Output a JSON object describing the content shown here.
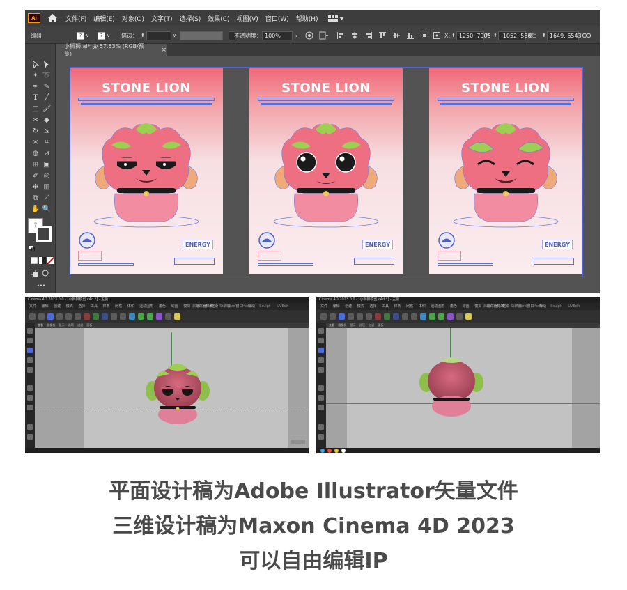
{
  "illustrator": {
    "logo": "Ai",
    "menu": [
      "文件(F)",
      "编辑(E)",
      "对象(O)",
      "文字(T)",
      "选择(S)",
      "效果(C)",
      "视图(V)",
      "窗口(W)",
      "帮助(H)"
    ],
    "control": {
      "group_label": "编组",
      "stroke_label": "描边：",
      "opacity_label": "不透明度：",
      "opacity_value": "100%",
      "x_label": "X:",
      "x_value": "1250. 7905",
      "y_label": "Y:",
      "y_value": "-1052. 586",
      "w_label": "宽：",
      "w_value": "1649. 6543"
    },
    "doc_tab": "小狮狮.ai* @ 57.53% (RGB/预览)",
    "doc_tab_close": "×",
    "artboards": [
      {
        "title": "STONE LION",
        "badge": "ENERGY",
        "expression": "sleepy"
      },
      {
        "title": "STONE LION",
        "badge": "ENERGY",
        "expression": "wide-eyed"
      },
      {
        "title": "STONE LION",
        "badge": "ENERGY",
        "expression": "happy"
      }
    ],
    "tools_more": "•••"
  },
  "c4d": {
    "left_title": "Cinema 4D 2023.0.0 - [小狮狮模型.c4d *] - 主要",
    "right_title": "Cinema 4D 2023.0.0 - [小狮狮模型.c4d *] - 主要",
    "menu": "文件 编辑 创建 模式 选择 工具 样条 网格 体积 运动图形 角色 动画 模拟 跟踪器 渲染 扩展 窗口 帮助",
    "layouts": [
      "启动",
      "标准",
      "Standard",
      "Model",
      "Sculpt",
      "UVEdit",
      "Paint"
    ],
    "view_menu": "查看 摄像机 显示 选项 过滤 面板",
    "view_name": "透视视图"
  },
  "captions": [
    "平面设计稿为Adobe Illustrator矢量文件",
    "三维设计稿为Maxon Cinema 4D 2023",
    "可以自由编辑IP"
  ],
  "colors": {
    "ai_chrome": "#3d3d3d",
    "ai_canvas": "#535353",
    "artboard_top": "#f06878",
    "lion_body": "#ee6f82",
    "lion_mane": "#9ccf52",
    "caption": "#4a4a4a"
  }
}
